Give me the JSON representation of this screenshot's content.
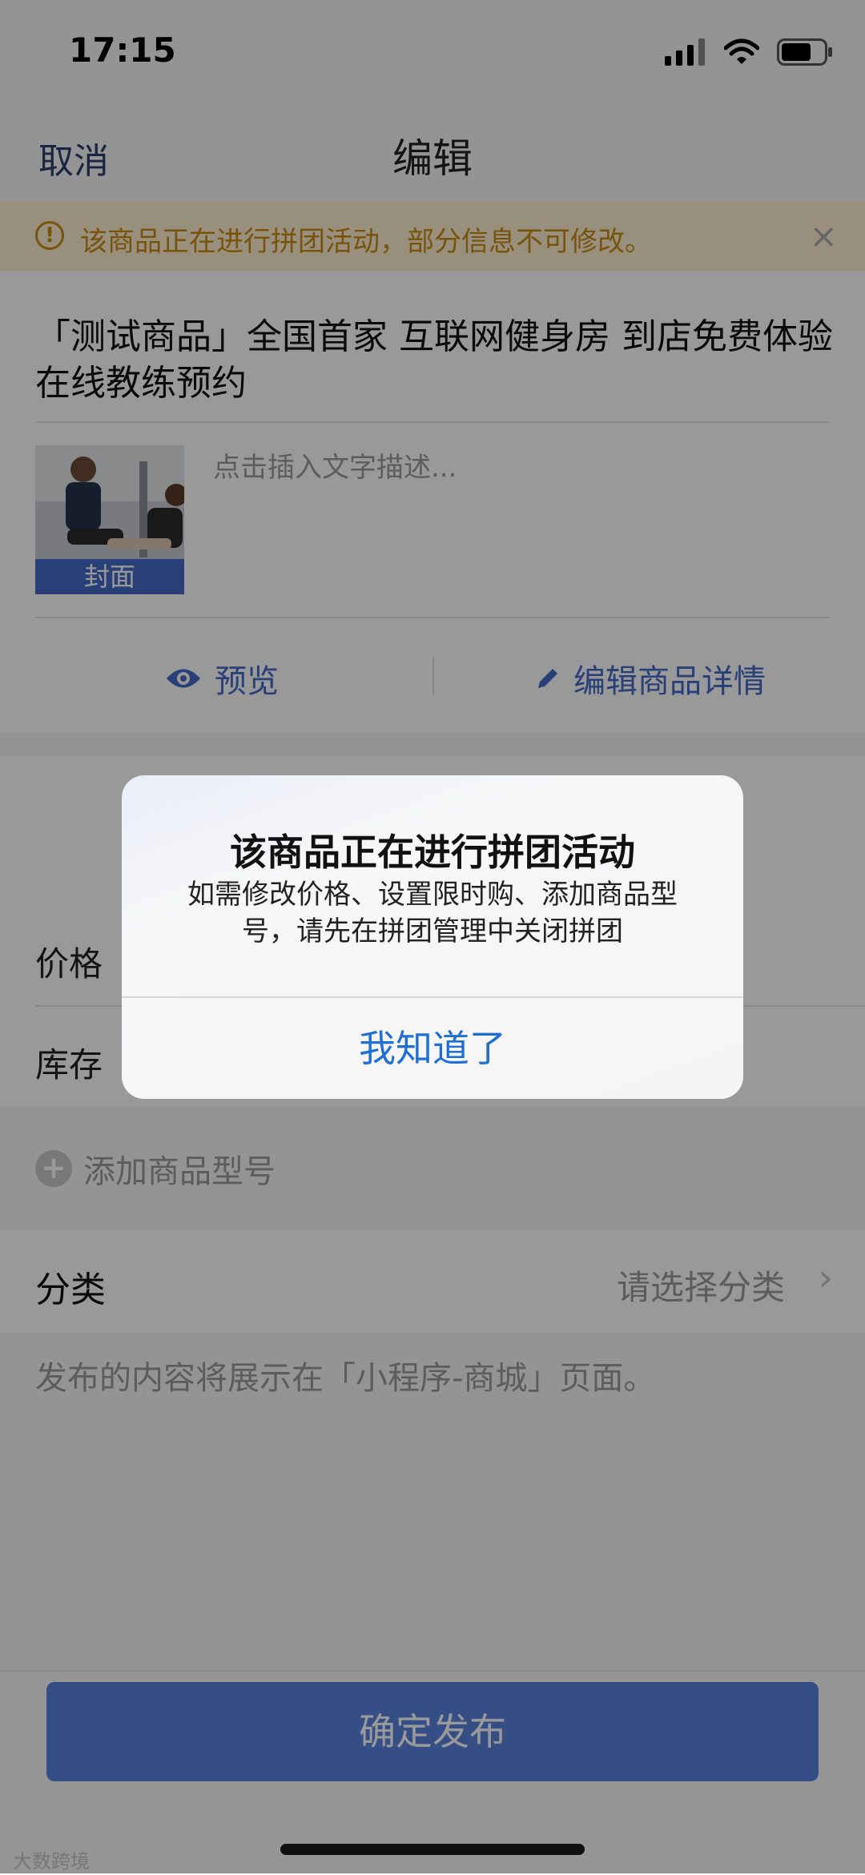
{
  "status_bar": {
    "time": "17:15"
  },
  "nav": {
    "cancel": "取消",
    "title": "编辑"
  },
  "notice": {
    "text": "该商品正在进行拼团活动，部分信息不可修改。",
    "close": "×"
  },
  "product": {
    "title": "「测试商品」全国首家 互联网健身房 到店免费体验 在线教练预约",
    "cover_label": "封面",
    "description_placeholder": "点击插入文字描述..."
  },
  "actions": {
    "preview": "预览",
    "edit_details": "编辑商品详情"
  },
  "form": {
    "price_label": "价格",
    "stock_label": "库存",
    "add_variant": "添加商品型号",
    "category_label": "分类",
    "category_value": "请选择分类"
  },
  "info_text": "发布的内容将展示在「小程序-商城」页面。",
  "publish_button": "确定发布",
  "watermark": "大数跨境",
  "dialog": {
    "title": "该商品正在进行拼团活动",
    "message": "如需修改价格、设置限时购、添加商品型号，请先在拼团管理中关闭拼团",
    "ok_button": "我知道了"
  },
  "colors": {
    "accent": "#4469c9",
    "notice": "#c98a14",
    "dialog_button": "#1f6fd6"
  }
}
